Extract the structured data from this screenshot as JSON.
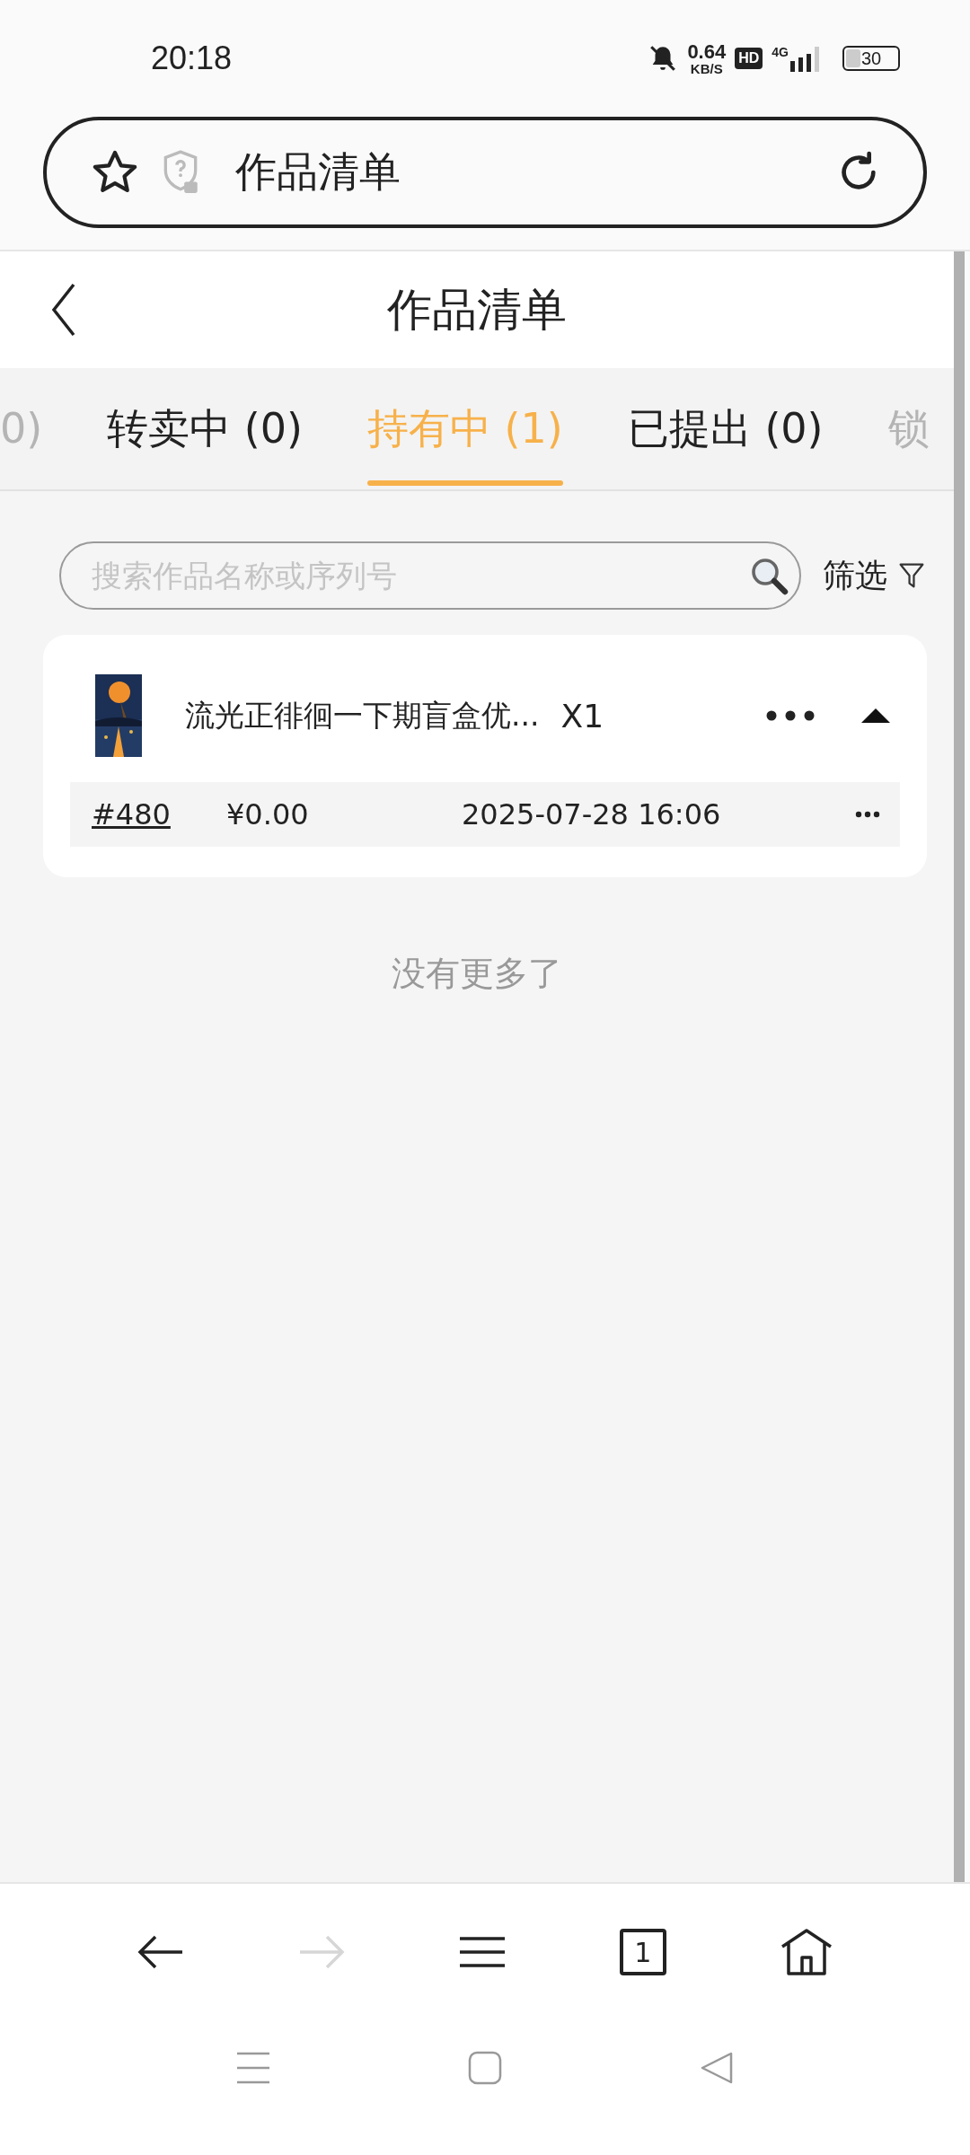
{
  "status_bar": {
    "time": "20:18",
    "speed": "0.64",
    "speed_unit": "KB/S",
    "hd": "HD",
    "network": "4G",
    "battery": "30"
  },
  "url_bar": {
    "title": "作品清单"
  },
  "header": {
    "title": "作品清单"
  },
  "tabs": [
    {
      "label": "0)",
      "selected": false
    },
    {
      "label": "转卖中 (0)",
      "selected": false
    },
    {
      "label": "持有中 (1)",
      "selected": true
    },
    {
      "label": "已提出 (0)",
      "selected": false
    },
    {
      "label": "锁",
      "selected": false
    }
  ],
  "search": {
    "placeholder": "搜索作品名称或序列号"
  },
  "filter": {
    "label": "筛选"
  },
  "items": [
    {
      "kind": "picture",
      "title": "流光正徘徊一下期盲盒优...",
      "quantity": "X1",
      "expanded": true,
      "entries": [
        {
          "serial": "#480",
          "price": "¥0.00",
          "time": "2025-07-28 16:06"
        }
      ]
    }
  ],
  "end_text": "没有更多了",
  "browser_toolbar": {
    "forward_disabled": true,
    "tab_count": "1"
  }
}
